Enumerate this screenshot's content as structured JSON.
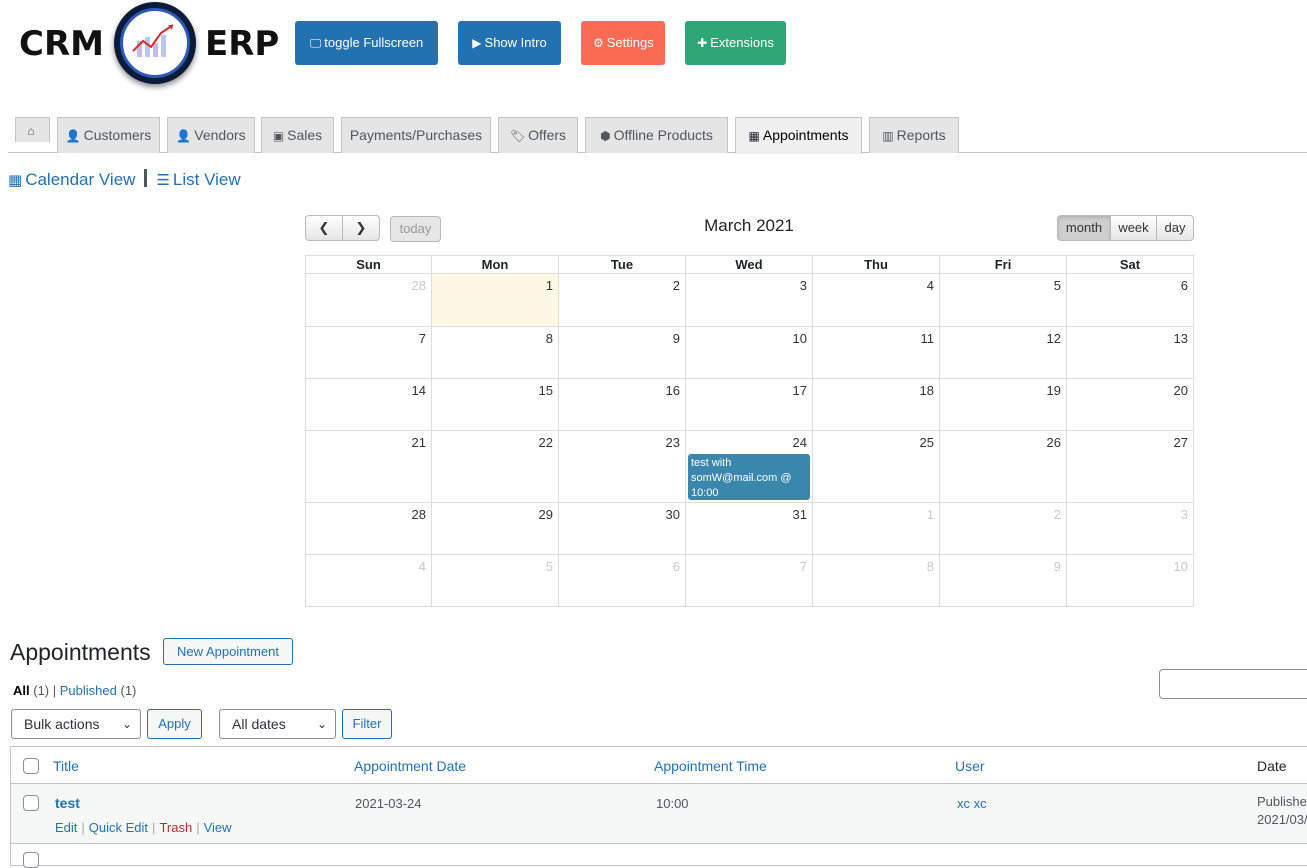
{
  "logo": {
    "word_left": "CRM",
    "word_right": "ERP"
  },
  "toolbar": [
    {
      "name": "toggle-fullscreen-button",
      "icon": "monitor-icon",
      "glyph": "🖵",
      "label": "toggle Fullscreen"
    },
    {
      "name": "show-intro-button",
      "icon": "play-icon",
      "glyph": "▶",
      "label": "Show Intro"
    },
    {
      "name": "settings-button",
      "icon": "gear-icon",
      "glyph": "⚙",
      "label": "Settings"
    },
    {
      "name": "extensions-button",
      "icon": "puzzle-icon",
      "glyph": "✚",
      "label": "Extensions"
    }
  ],
  "colors": {
    "primary": "#2271b1",
    "settings": "#fb6b53",
    "extensions": "#2ea774",
    "event": "#3a87ad",
    "today": "#fcf8e3"
  },
  "tabs": [
    {
      "icon": "home-icon",
      "glyph": "⌂",
      "label": ""
    },
    {
      "icon": "user-icon",
      "glyph": "👤",
      "label": "Customers"
    },
    {
      "icon": "user-icon",
      "glyph": "👤",
      "label": "Vendors"
    },
    {
      "icon": "money-icon",
      "glyph": "▣",
      "label": "Sales"
    },
    {
      "icon": "",
      "glyph": "",
      "label": "Payments/Purchases"
    },
    {
      "icon": "tags-icon",
      "glyph": "🏷",
      "label": "Offers"
    },
    {
      "icon": "cube-icon",
      "glyph": "⬢",
      "label": "Offline Products"
    },
    {
      "icon": "calendar-icon",
      "glyph": "▦",
      "label": "Appointments",
      "active": true
    },
    {
      "icon": "bar-chart-icon",
      "glyph": "▥",
      "label": "Reports"
    }
  ],
  "views": {
    "calendar_label": "Calendar View",
    "list_label": "List View"
  },
  "calendar": {
    "title": "March 2021",
    "today_label": "today",
    "view_month": "month",
    "view_week": "week",
    "view_day": "day",
    "active_view": "month",
    "weekdays": [
      "Sun",
      "Mon",
      "Tue",
      "Wed",
      "Thu",
      "Fri",
      "Sat"
    ],
    "weeks": [
      [
        28,
        1,
        2,
        3,
        4,
        5,
        6
      ],
      [
        7,
        8,
        9,
        10,
        11,
        12,
        13
      ],
      [
        14,
        15,
        16,
        17,
        18,
        19,
        20
      ],
      [
        21,
        22,
        23,
        24,
        25,
        26,
        27
      ],
      [
        28,
        29,
        30,
        31,
        1,
        2,
        3
      ],
      [
        4,
        5,
        6,
        7,
        8,
        9,
        10
      ]
    ],
    "today_day": 1,
    "event": {
      "day": 24,
      "text": "test with somW@mail.com @ 10:00"
    }
  },
  "list": {
    "heading": "Appointments",
    "new_button": "New Appointment",
    "filter_all": "All",
    "filter_all_count": "(1)",
    "filter_published": "Published",
    "filter_published_count": "(1)",
    "bulk_actions": "Bulk actions",
    "apply": "Apply",
    "all_dates": "All dates",
    "filter": "Filter",
    "columns": {
      "title": "Title",
      "date_col": "Appointment Date",
      "time_col": "Appointment Time",
      "user": "User",
      "date": "Date"
    },
    "row": {
      "title": "test",
      "appointment_date": "2021-03-24",
      "appointment_time": "10:00",
      "user": "xc xc",
      "status": "Published",
      "published_date": "2021/03/",
      "actions": {
        "edit": "Edit",
        "quick_edit": "Quick Edit",
        "trash": "Trash",
        "view": "View"
      }
    }
  }
}
